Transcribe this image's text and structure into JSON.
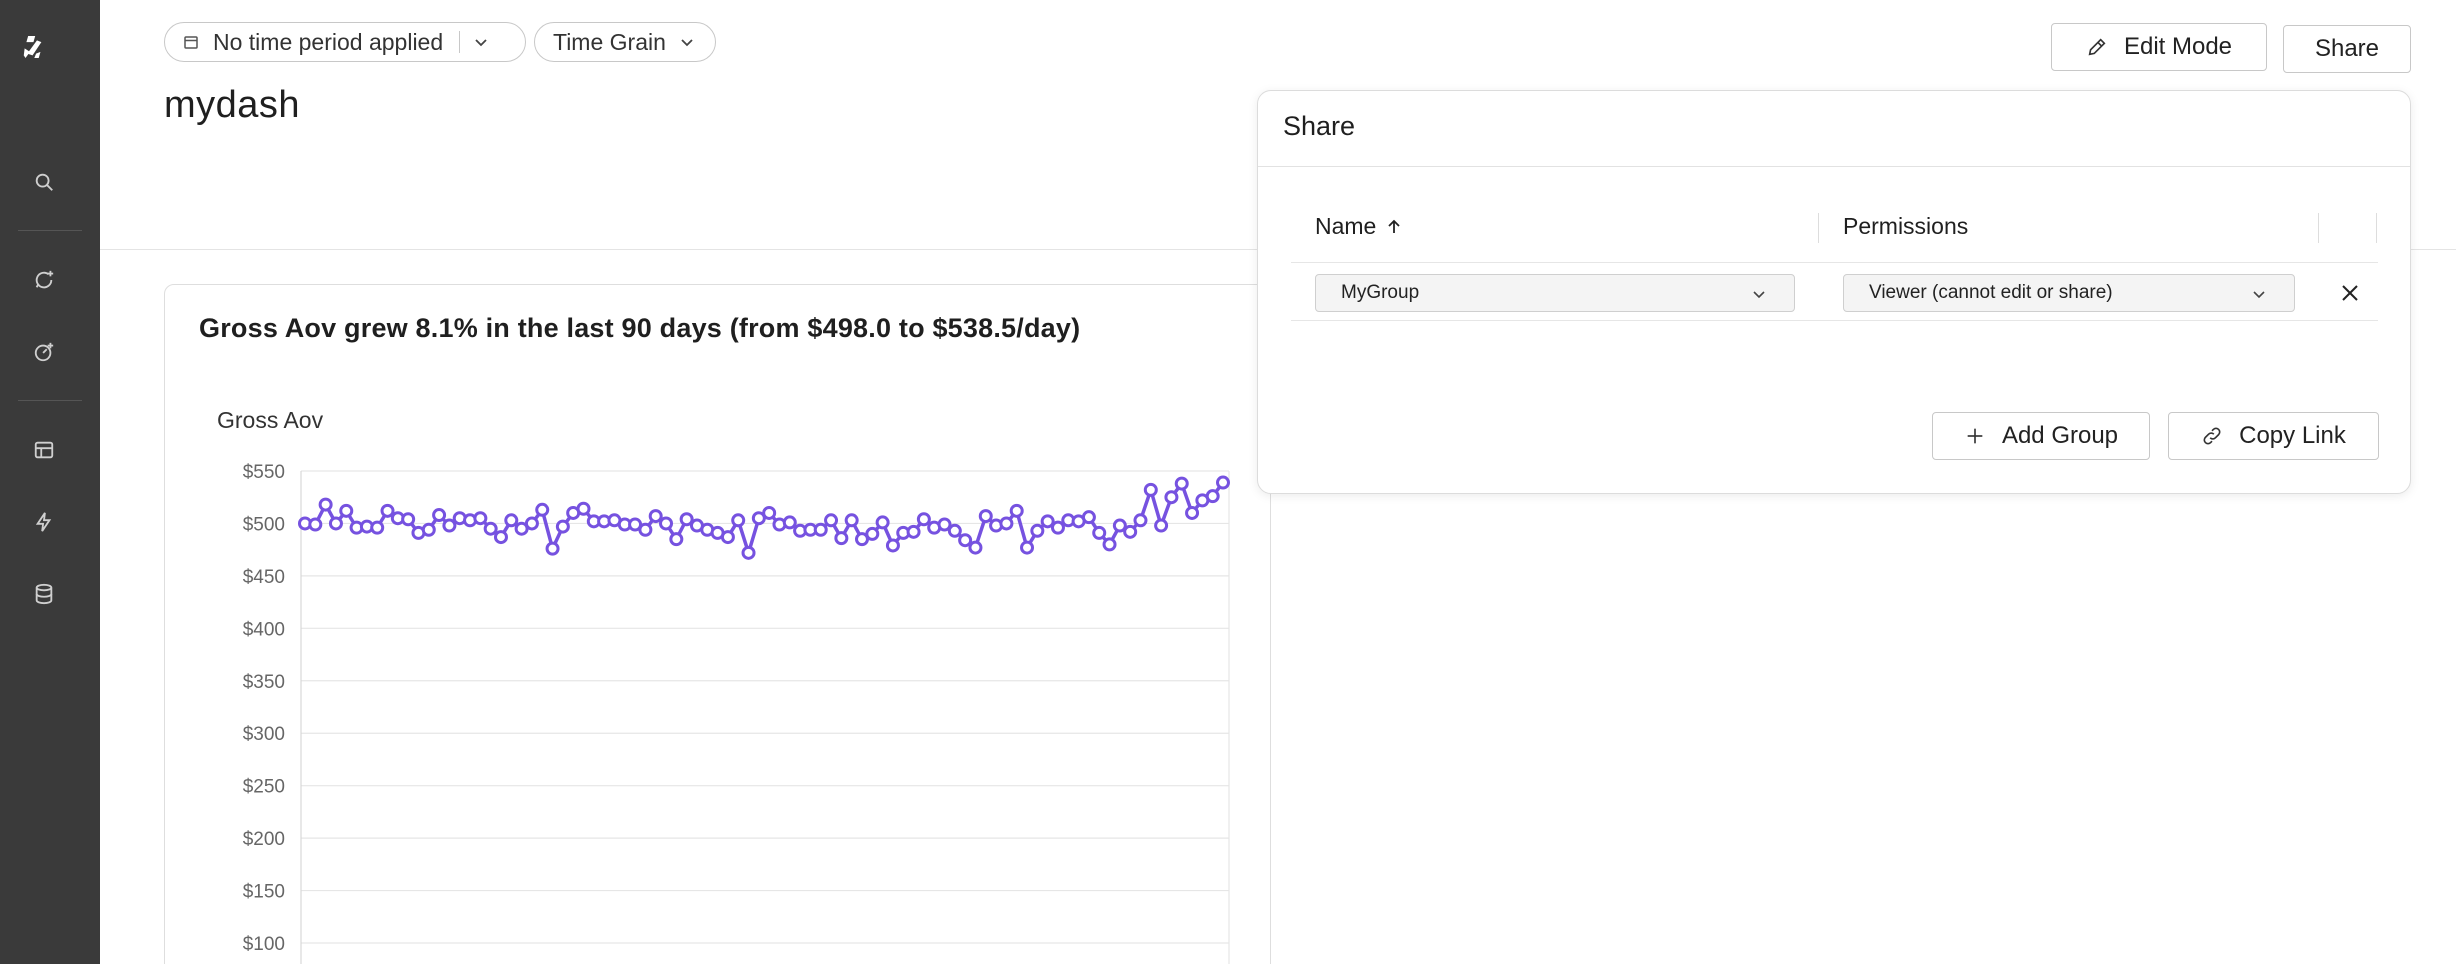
{
  "filters": {
    "time_period_label": "No time period applied",
    "time_grain_label": "Time Grain"
  },
  "dashboard": {
    "title": "mydash"
  },
  "header": {
    "edit_mode_label": "Edit Mode",
    "share_label": "Share"
  },
  "card": {
    "title": "Gross Aov grew 8.1% in the last 90 days (from $498.0 to $538.5/day)"
  },
  "share_dialog": {
    "title": "Share",
    "columns": [
      "Name",
      "Permissions"
    ],
    "rows": [
      {
        "name": "MyGroup",
        "permission": "Viewer (cannot edit or share)"
      }
    ],
    "add_group_label": "Add Group",
    "copy_link_label": "Copy Link"
  },
  "nav_icons": [
    "logo",
    "search-icon",
    "new-chat-icon",
    "new-dashboard-icon",
    "table-icon",
    "bolt-icon",
    "database-icon"
  ],
  "colors": {
    "rail_bg": "#3a3a3a",
    "series": "#7652e0",
    "gridline": "#e6e6e6"
  },
  "chart_data": {
    "type": "line",
    "ylabel": "Gross Aov",
    "y_tick_labels": [
      "$550",
      "$500",
      "$450",
      "$400",
      "$350",
      "$300",
      "$250",
      "$200",
      "$150",
      "$100"
    ],
    "y_ticks": [
      550,
      500,
      450,
      400,
      350,
      300,
      250,
      200,
      150,
      100
    ],
    "ylim": [
      100,
      550
    ],
    "grid": true,
    "series": [
      {
        "values": [
          500,
          499,
          518,
          500,
          512,
          496,
          497,
          496,
          512,
          505,
          504,
          491,
          494,
          508,
          498,
          505,
          503,
          505,
          495,
          487,
          503,
          495,
          500,
          513,
          476,
          497,
          510,
          514,
          502,
          502,
          503,
          499,
          499,
          494,
          507,
          500,
          485,
          504,
          498,
          494,
          491,
          487,
          503,
          472,
          505,
          510,
          499,
          501,
          493,
          494,
          494,
          503,
          486,
          503,
          485,
          490,
          501,
          479,
          491,
          492,
          504,
          496,
          499,
          493,
          484,
          477,
          507,
          498,
          500,
          512,
          477,
          493,
          502,
          496,
          503,
          502,
          506,
          491,
          480,
          498,
          492,
          503,
          532,
          498,
          525,
          538,
          510,
          522,
          526,
          539
        ]
      }
    ]
  }
}
